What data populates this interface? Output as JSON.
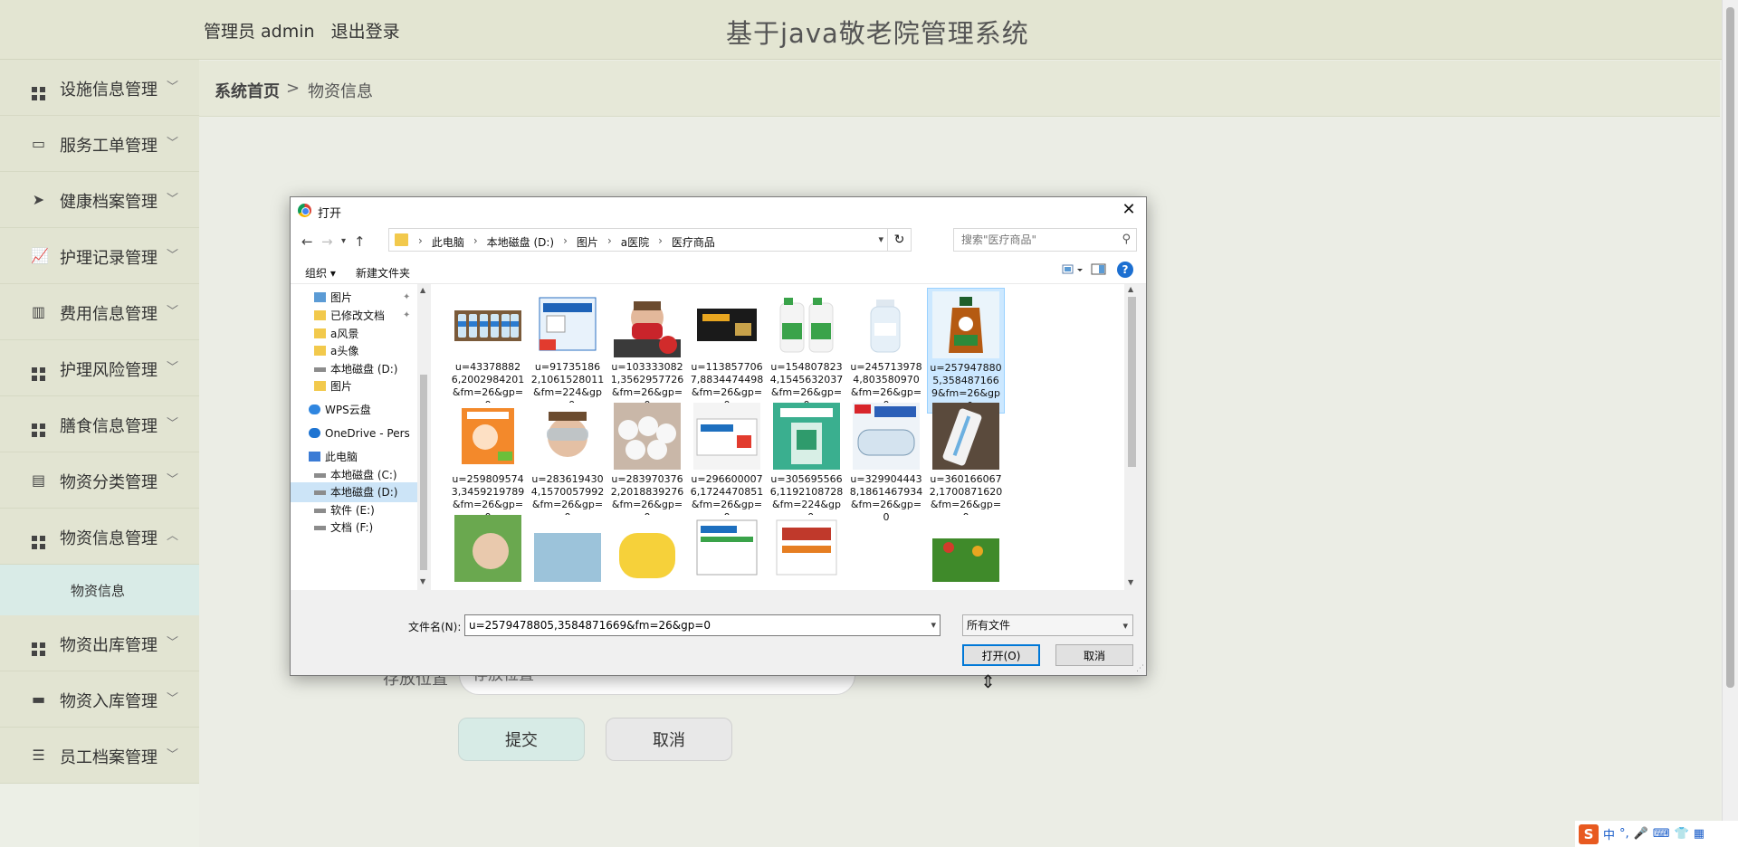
{
  "header": {
    "user_label": "管理员 admin",
    "logout_label": "退出登录",
    "app_title": "基于java敬老院管理系统"
  },
  "sidebar": {
    "items": [
      {
        "label": "设施信息管理",
        "icon": "grid-icon"
      },
      {
        "label": "服务工单管理",
        "icon": "monitor-icon"
      },
      {
        "label": "健康档案管理",
        "icon": "paper-plane-icon"
      },
      {
        "label": "护理记录管理",
        "icon": "line-chart-icon"
      },
      {
        "label": "费用信息管理",
        "icon": "book-icon"
      },
      {
        "label": "护理风险管理",
        "icon": "grid-icon"
      },
      {
        "label": "膳食信息管理",
        "icon": "grid-icon"
      },
      {
        "label": "物资分类管理",
        "icon": "clipboard-icon"
      },
      {
        "label": "物资信息管理",
        "icon": "grid-icon",
        "expanded": true
      },
      {
        "label": "物资出库管理",
        "icon": "grid-icon"
      },
      {
        "label": "物资入库管理",
        "icon": "briefcase-icon"
      },
      {
        "label": "员工档案管理",
        "icon": "sliders-icon"
      }
    ],
    "submenu": {
      "label": "物资信息"
    }
  },
  "breadcrumb": {
    "home": "系统首页",
    "separator": ">",
    "current": "物资信息"
  },
  "form": {
    "storage_label": "存放位置",
    "storage_placeholder": "存放位置",
    "submit_label": "提交",
    "cancel_label": "取消"
  },
  "dialog": {
    "title": "打开",
    "path": [
      "此电脑",
      "本地磁盘 (D:)",
      "图片",
      "a医院",
      "医疗商品"
    ],
    "search_placeholder": "搜索\"医疗商品\"",
    "toolbar": {
      "organize": "组织 ▾",
      "new_folder": "新建文件夹"
    },
    "nav_items": [
      {
        "label": "图片",
        "icon": "folder-blue-icon",
        "pinned": true
      },
      {
        "label": "已修改文档",
        "icon": "folder-icon",
        "pinned": true
      },
      {
        "label": "a风景",
        "icon": "folder-icon"
      },
      {
        "label": "a头像",
        "icon": "folder-icon"
      },
      {
        "label": "本地磁盘 (D:)",
        "icon": "drive-icon"
      },
      {
        "label": "图片",
        "icon": "folder-icon"
      },
      {
        "label": "WPS云盘",
        "icon": "wps-cloud-icon"
      },
      {
        "label": "OneDrive - Pers",
        "icon": "onedrive-icon"
      },
      {
        "label": "此电脑",
        "icon": "pc-icon"
      },
      {
        "label": "本地磁盘 (C:)",
        "icon": "drive-icon"
      },
      {
        "label": "本地磁盘 (D:)",
        "icon": "drive-icon",
        "selected": true
      },
      {
        "label": "软件 (E:)",
        "icon": "drive-icon"
      },
      {
        "label": "文档 (F:)",
        "icon": "drive-icon"
      }
    ],
    "files": [
      {
        "name": "u=433788826,2002984201&fm=26&gp=0",
        "thumb": "water-bottles"
      },
      {
        "name": "u=917351862,1061528011&fm=224&gp=0",
        "thumb": "medicine-box-blue"
      },
      {
        "name": "u=1033330821,3562957726&fm=26&gp=0",
        "thumb": "red-mask"
      },
      {
        "name": "u=1138577067,8834474498&fm=26&gp=0",
        "thumb": "black-box"
      },
      {
        "name": "u=1548078234,1545632037&fm=26&gp=0",
        "thumb": "green-jugs"
      },
      {
        "name": "u=2457139784,803580970&fm=26&gp=0",
        "thumb": "alcohol-bottle"
      },
      {
        "name": "u=2579478805,3584871669&fm=26&gp=0",
        "thumb": "dettol-bottle",
        "selected": true
      },
      {
        "name": "u=2598095743,3459219789&fm=26&gp=0",
        "thumb": "orange-box"
      },
      {
        "name": "u=2836194304,1570057992&fm=26&gp=0",
        "thumb": "goggles-face"
      },
      {
        "name": "u=2839703762,2018839276&fm=26&gp=0",
        "thumb": "cotton-pads"
      },
      {
        "name": "u=2966000076,1724470851&fm=26&gp=0",
        "thumb": "white-box"
      },
      {
        "name": "u=3056955666,1192108728&fm=224&gp=0",
        "thumb": "granules-green"
      },
      {
        "name": "u=3299044438,1861467934&fm=26&gp=0",
        "thumb": "3m-goggles"
      },
      {
        "name": "u=3601660672,1700871620&fm=26&gp=0",
        "thumb": "thermometer"
      }
    ],
    "row3_thumbs": [
      "hand-green",
      "blue-item",
      "yellow-round",
      "medicine-box-2",
      "cold-granules",
      "",
      "vegetables"
    ],
    "filename_label": "文件名(N):",
    "filename_value": "u=2579478805,3584871669&fm=26&gp=0",
    "filetype": "所有文件",
    "open_label": "打开(O)",
    "cancel_label": "取消"
  },
  "tray": {
    "ime_lang": "中",
    "ime_punct": "°,"
  }
}
